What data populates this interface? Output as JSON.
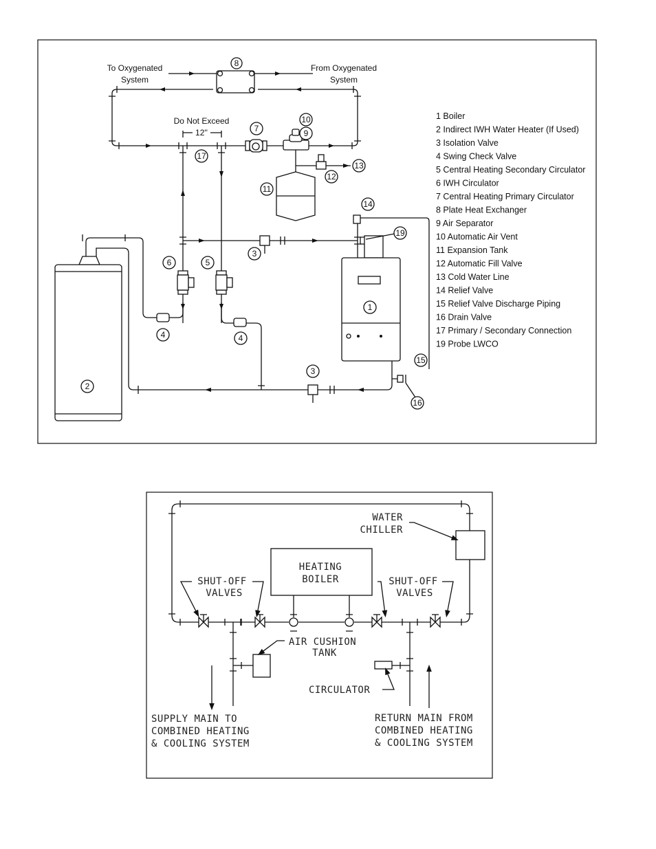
{
  "diagram1": {
    "to_system": [
      "To Oxygenated",
      "System"
    ],
    "from_system": [
      "From Oxygenated",
      "System"
    ],
    "dimension_note": "Do Not Exceed",
    "dimension_value": "12''",
    "callouts": {
      "boiler": "1",
      "water_heater": "2",
      "isolation_valve_top": "3",
      "isolation_valve_bottom": "3",
      "check_valve_left": "4",
      "check_valve_right": "4",
      "secondary_circulator": "5",
      "iwh_circulator": "6",
      "primary_circulator": "7",
      "plate_hx": "8",
      "air_separator": "9",
      "air_vent": "10",
      "expansion_tank": "11",
      "fill_valve": "12",
      "cold_water": "13",
      "relief_valve": "14",
      "discharge": "15",
      "drain_valve": "16",
      "primary_secondary": "17",
      "probe_lwco": "19"
    },
    "legend": [
      "1 Boiler",
      "2 Indirect IWH Water Heater (If Used)",
      "3 Isolation Valve",
      "4 Swing Check Valve",
      "5 Central Heating Secondary Circulator",
      "6 IWH Circulator",
      "7 Central Heating Primary Circulator",
      "8 Plate Heat Exchanger",
      "9 Air Separator",
      "10 Automatic Air Vent",
      "11 Expansion Tank",
      "12 Automatic Fill Valve",
      "13 Cold Water Line",
      "14 Relief Valve",
      "15 Relief Valve Discharge Piping",
      "16 Drain Valve",
      "17 Primary / Secondary Connection",
      "19 Probe LWCO"
    ]
  },
  "diagram2": {
    "water_chiller": [
      "WATER",
      "CHILLER"
    ],
    "heating_boiler": [
      "HEATING",
      "BOILER"
    ],
    "shutoff_left": [
      "SHUT-OFF",
      "VALVES"
    ],
    "shutoff_right": [
      "SHUT-OFF",
      "VALVES"
    ],
    "air_cushion_tank": [
      "AIR CUSHION",
      "TANK"
    ],
    "circulator": "CIRCULATOR",
    "supply_main": [
      "SUPPLY MAIN TO",
      "COMBINED HEATING",
      "& COOLING SYSTEM"
    ],
    "return_main": [
      "RETURN MAIN FROM",
      "COMBINED HEATING",
      "& COOLING SYSTEM"
    ]
  }
}
